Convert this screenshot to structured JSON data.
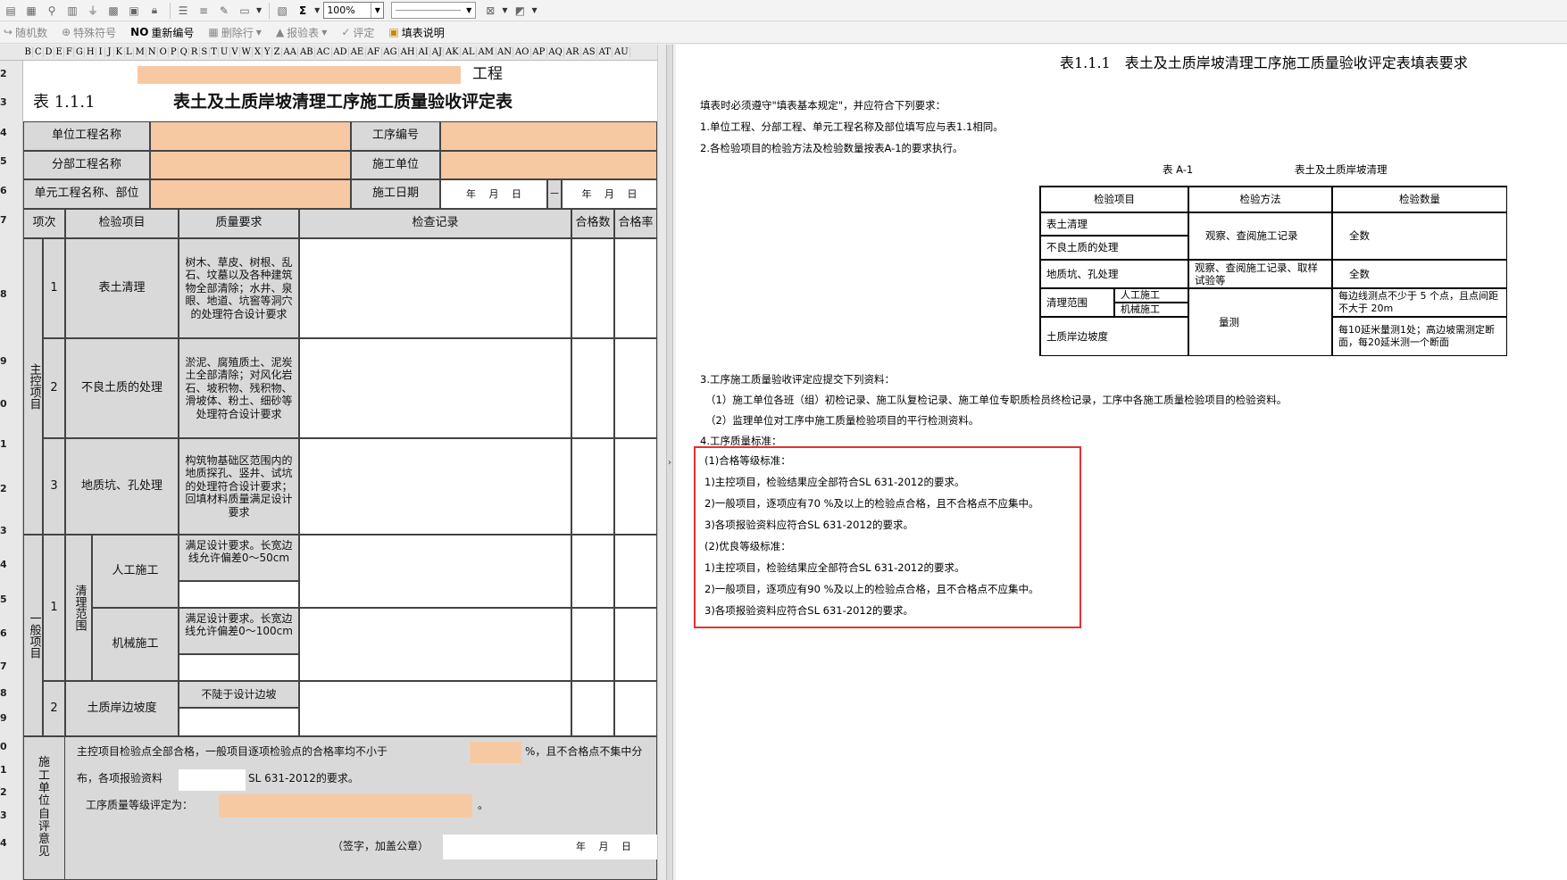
{
  "toolbar": {
    "zoom": "100%",
    "sum_symbol": "Σ",
    "items2": [
      {
        "icon": "↪",
        "label": "随机数",
        "enabled": false
      },
      {
        "icon": "⊕",
        "label": "特殊符号",
        "enabled": false
      },
      {
        "icon": "NO",
        "label": "重新编号",
        "enabled": true
      },
      {
        "icon": "▦",
        "label": "删除行",
        "enabled": false
      },
      {
        "icon": "▲",
        "label": "报验表",
        "enabled": false
      },
      {
        "icon": "✓",
        "label": "评定",
        "enabled": false
      },
      {
        "icon": "▣",
        "label": "填表说明",
        "enabled": true
      }
    ]
  },
  "columns": [
    "B",
    "C",
    "D",
    "E",
    "F",
    "G",
    "H",
    "I",
    "J",
    "K",
    "L",
    "M",
    "N",
    "O",
    "P",
    "Q",
    "R",
    "S",
    "T",
    "U",
    "V",
    "W",
    "X",
    "Y",
    "Z",
    "AA",
    "AB",
    "AC",
    "AD",
    "AE",
    "AF",
    "AG",
    "AH",
    "AI",
    "AJ",
    "AK",
    "AL",
    "AM",
    "AN",
    "AO",
    "AP",
    "AQ",
    "AR",
    "AS",
    "AT",
    "AU"
  ],
  "rows": [
    "2",
    "3",
    "4",
    "5",
    "6",
    "7",
    "8",
    "9",
    "0",
    "1",
    "2",
    "3",
    "4",
    "5",
    "6",
    "7",
    "8",
    "9",
    "0",
    "1",
    "2",
    "3",
    "4"
  ],
  "form": {
    "project_suffix": "工程",
    "table_no": "表 1.1.1",
    "title": "表土及土质岸坡清理工序施工质量验收评定表",
    "unit_project_label": "单位工程名称",
    "process_no_label": "工序编号",
    "sub_project_label": "分部工程名称",
    "contractor_label": "施工单位",
    "element_project_label": "单元工程名称、部位",
    "date_label": "施工日期",
    "date_tpl": "年　 月　 日",
    "date_sep": "－",
    "headers": {
      "item_no": "项次",
      "item": "检验项目",
      "req": "质量要求",
      "record": "检查记录",
      "qualified": "合格数",
      "rate": "合格率"
    },
    "main_items_label": "主控项目",
    "general_items_label": "一般项目",
    "main_items": [
      {
        "no": "1",
        "name": "表土清理",
        "req": "树木、草皮、树根、乱石、坟墓以及各种建筑物全部清除；水井、泉眼、地道、坑窖等洞穴的处理符合设计要求"
      },
      {
        "no": "2",
        "name": "不良土质的处理",
        "req": "淤泥、腐殖质土、泥炭土全部清除；对风化岩石、坡积物、残积物、滑坡体、粉土、细砂等处理符合设计要求"
      },
      {
        "no": "3",
        "name": "地质坑、孔处理",
        "req": "构筑物基础区范围内的地质探孔、竖井、试坑的处理符合设计要求；回填材料质量满足设计要求"
      }
    ],
    "general_items": {
      "no1": "1",
      "group": "清理范围",
      "manual": {
        "name": "人工施工",
        "req": "满足设计要求。长宽边线允许偏差0～50cm"
      },
      "machine": {
        "name": "机械施工",
        "req": "满足设计要求。长宽边线允许偏差0～100cm"
      },
      "no2": "2",
      "slope": {
        "name": "土质岸边坡度",
        "req": "不陡于设计边坡"
      }
    },
    "self_eval_label": "施工单位自评意见",
    "eval_line1a": "主控项目检验点全部合格，一般项目逐项检验点的合格率均不小于",
    "eval_line1b": "%，且不合格点不集中分",
    "eval_line2a": "布，各项报验资料",
    "eval_line2b": "SL 631-2012的要求。",
    "eval_line3": "工序质量等级评定为：",
    "eval_period": "。",
    "sign": "（签字，加盖公章）",
    "sign_date": "年　 月　 日"
  },
  "guide": {
    "title": "表1.1.1　表土及土质岸坡清理工序施工质量验收评定表填表要求",
    "intro": "填表时必须遵守\"填表基本规定\"，并应符合下列要求：",
    "p1": "1.单位工程、分部工程、单元工程名称及部位填写应与表1.1相同。",
    "p2": "2.各检验项目的检验方法及检验数量按表A-1的要求执行。",
    "tableA_caption_left": "表 A-1",
    "tableA_caption_right": "表土及土质岸坡清理",
    "tableA_headers": [
      "检验项目",
      "检验方法",
      "检验数量"
    ],
    "tableA": {
      "r1": "表土清理",
      "r2": "不良土质的处理",
      "m12": "观察、查阅施工记录",
      "q12": "全数",
      "r3": "地质坑、孔处理",
      "m3": "观察、查阅施工记录、取样试验等",
      "q3": "全数",
      "r4": "清理范围",
      "r4a": "人工施工",
      "r4b": "机械施工",
      "q4": "每边线测点不少于 5 个点，且点间距不大于 20m",
      "r5": "土质岸边坡度",
      "m45": "量测",
      "q5": "每10延米量测1处；高边坡需测定断面，每20延米测一个断面"
    },
    "p3": "3.工序施工质量验收评定应提交下列资料：",
    "p3a": "（1）施工单位各班（组）初检记录、施工队复检记录、施工单位专职质检员终检记录，工序中各施工质量检验项目的检验资料。",
    "p3b": "（2）监理单位对工序中施工质量检验项目的平行检测资料。",
    "p4": "4.工序质量标准：",
    "std": [
      "(1)合格等级标准：",
      "1)主控项目，检验结果应全部符合SL 631-2012的要求。",
      "2)一般项目，逐项应有70 %及以上的检验点合格，且不合格点不应集中。",
      "3)各项报验资料应符合SL 631-2012的要求。",
      "(2)优良等级标准：",
      "1)主控项目，检验结果应全部符合SL 631-2012的要求。",
      "2)一般项目，逐项应有90 %及以上的检验点合格，且不合格点不应集中。",
      "3)各项报验资料应符合SL 631-2012的要求。"
    ]
  },
  "colors": {
    "input_fill": "#f7c9a3",
    "label_fill": "#d9d9d9",
    "highlight": "#e33232"
  }
}
